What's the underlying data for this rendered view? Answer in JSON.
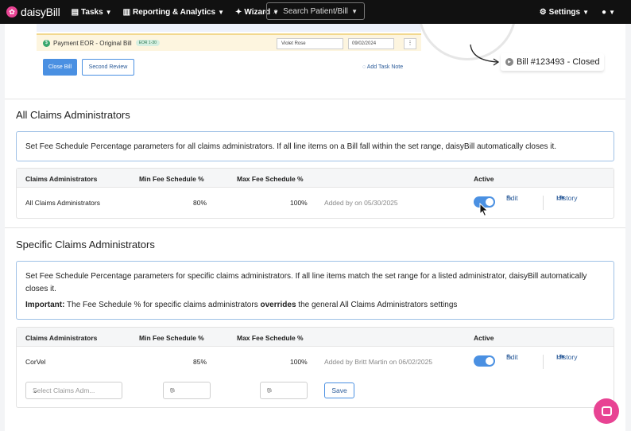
{
  "nav": {
    "brand": "daisyBill",
    "items": [
      {
        "label": "Tasks",
        "icon": "clipboard-icon"
      },
      {
        "label": "Reporting & Analytics",
        "icon": "chart-icon"
      },
      {
        "label": "Wizard",
        "icon": "wand-icon"
      }
    ],
    "search": "Search Patient/Bill",
    "settings": "Settings"
  },
  "illustration": {
    "bar_title": "Payment EOR - Original Bill",
    "bar_tag": "EOR 1-30",
    "assignee": "Violet Rose",
    "date": "09/02/2024",
    "close_bill": "Close Bill",
    "second_review": "Second Review",
    "add_task_note": "Add Task Note",
    "closed_label": "Bill #123493 - Closed"
  },
  "all_admins": {
    "title": "All Claims Administrators",
    "info": "Set Fee Schedule Percentage parameters for all claims administrators. If all line items on a Bill fall within the set range, daisyBill automatically closes it.",
    "headers": {
      "admin": "Claims Administrators",
      "min": "Min Fee Schedule %",
      "max": "Max Fee Schedule %",
      "active": "Active"
    },
    "row": {
      "admin": "All Claims Administrators",
      "min": "80%",
      "max": "100%",
      "added": "Added by on 05/30/2025",
      "edit": "Edit",
      "history": "History"
    }
  },
  "specific_admins": {
    "title": "Specific Claims Administrators",
    "info_line": "Set Fee Schedule Percentage parameters for specific claims administrators. If all line items match the set range for a listed administrator, daisyBill automatically closes it.",
    "important_label": "Important:",
    "important_pre": " The Fee Schedule % for specific claims administrators ",
    "important_bold": "overrides",
    "important_post": " the general All Claims Administrators settings",
    "headers": {
      "admin": "Claims Administrators",
      "min": "Min Fee Schedule %",
      "max": "Max Fee Schedule %",
      "active": "Active"
    },
    "row": {
      "admin": "CorVel",
      "min": "85%",
      "max": "100%",
      "added": "Added by Britt Martin on 06/02/2025",
      "edit": "Edit",
      "history": "History"
    },
    "new_row": {
      "select_placeholder": "Select Claims Adm...",
      "min_value": "0",
      "max_value": "0",
      "suffix": "%",
      "save": "Save"
    }
  }
}
